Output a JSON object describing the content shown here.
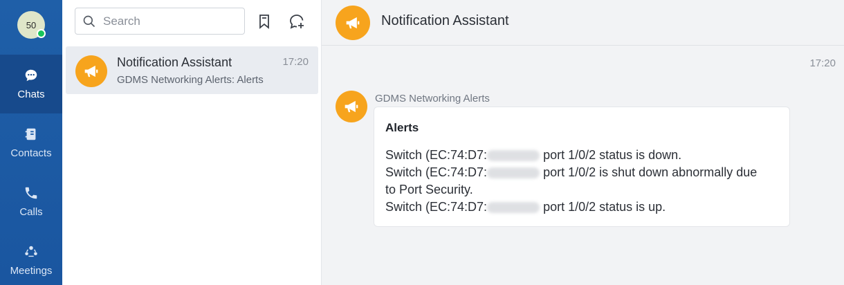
{
  "user": {
    "avatar_text": "50",
    "presence": "online"
  },
  "nav": {
    "items": [
      {
        "label": "Chats",
        "icon": "chat-bubble-icon",
        "active": true
      },
      {
        "label": "Contacts",
        "icon": "address-book-icon",
        "active": false
      },
      {
        "label": "Calls",
        "icon": "phone-icon",
        "active": false
      },
      {
        "label": "Meetings",
        "icon": "meetings-icon",
        "active": false
      }
    ]
  },
  "search": {
    "placeholder": "Search"
  },
  "chat_list": [
    {
      "name": "Notification Assistant",
      "time": "17:20",
      "preview": "GDMS Networking Alerts: Alerts",
      "icon": "megaphone-icon"
    }
  ],
  "conversation": {
    "title": "Notification Assistant",
    "timestamp": "17:20",
    "message": {
      "sender": "GDMS Networking Alerts",
      "title": "Alerts",
      "lines": [
        {
          "prefix": "Switch  (EC:74:D7:",
          "suffix": " port 1/0/2 status is down."
        },
        {
          "prefix": "Switch  (EC:74:D7:",
          "suffix": " port 1/0/2 is shut down abnormally due"
        },
        {
          "text": "to Port Security."
        },
        {
          "prefix": "Switch  (EC:74:D7:",
          "suffix": " port 1/0/2 status is up."
        }
      ]
    }
  },
  "colors": {
    "rail": "#1f5fa8",
    "rail_active": "#174a8c",
    "accent": "#f7a41d",
    "presence": "#18c45b"
  }
}
